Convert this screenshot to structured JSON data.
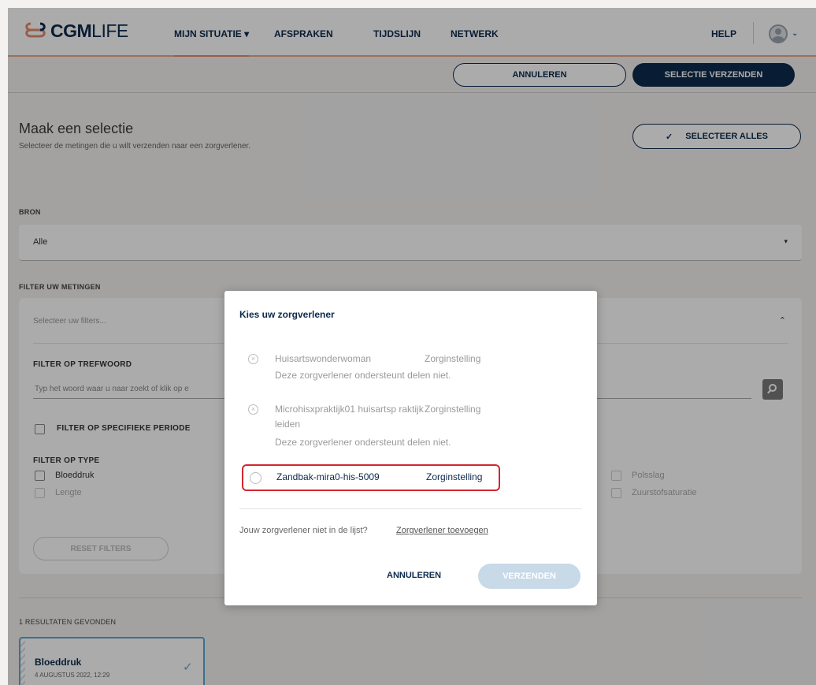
{
  "app": {
    "logo_bold": "CGM",
    "logo_light": "LIFE",
    "accent": "#e58b6a",
    "navy": "#0c2a4c"
  },
  "nav": {
    "items": [
      {
        "label": "MIJN SITUATIE ▾",
        "active": true
      },
      {
        "label": "AFSPRAKEN",
        "active": false
      },
      {
        "label": "TIJDSLIJN",
        "active": false
      },
      {
        "label": "NETWERK",
        "active": false
      }
    ],
    "help": "HELP",
    "avatar_caret": "⌄"
  },
  "actionbar": {
    "cancel": "ANNULEREN",
    "send": "SELECTIE VERZENDEN"
  },
  "page": {
    "title": "Maak een selectie",
    "subtitle": "Selecteer de metingen die u wilt verzenden naar een zorgverlener.",
    "select_all_check": "✓",
    "select_all": "SELECTEER ALLES"
  },
  "source": {
    "label": "BRON",
    "value": "Alle",
    "caret": "▾"
  },
  "filters": {
    "label": "FILTER UW METINGEN",
    "placeholder": "Selecteer uw filters...",
    "chevron": "⌃",
    "keyword_label": "FILTER OP TREFWOORD",
    "keyword_placeholder": "Typ het woord waar u naar zoekt of klik op e",
    "period": "FILTER OP SPECIFIEKE PERIODE",
    "type_label": "FILTER OP TYPE",
    "types_left": [
      "Bloeddruk",
      "Lengte"
    ],
    "types_right": [
      "Polsslag",
      "Zuurstofsaturatie"
    ],
    "reset": "RESET FILTERS"
  },
  "results": {
    "count": "1 RESULTATEN GEVONDEN",
    "items": [
      {
        "title": "Bloeddruk",
        "date": "4 AUGUSTUS 2022, 12:29",
        "check": "✓"
      }
    ]
  },
  "modal": {
    "title": "Kies uw zorgverlener",
    "disabled_icon": "×",
    "providers": [
      {
        "name": "Huisartswonderwoman",
        "type": "Zorginstelling",
        "note": "Deze zorgverlener ondersteunt delen niet."
      },
      {
        "name": "Microhisxpraktijk01 huisartsp raktijk leiden",
        "type": "Zorginstelling",
        "note": "Deze zorgverlener ondersteunt delen niet."
      }
    ],
    "selectable": {
      "name": "Zandbak-mira0-his-5009",
      "type": "Zorginstelling"
    },
    "not_listed": "Jouw zorgverlener niet in de lijst?",
    "add_link": "Zorgverlener toevoegen",
    "cancel": "ANNULEREN",
    "send": "VERZENDEN"
  }
}
